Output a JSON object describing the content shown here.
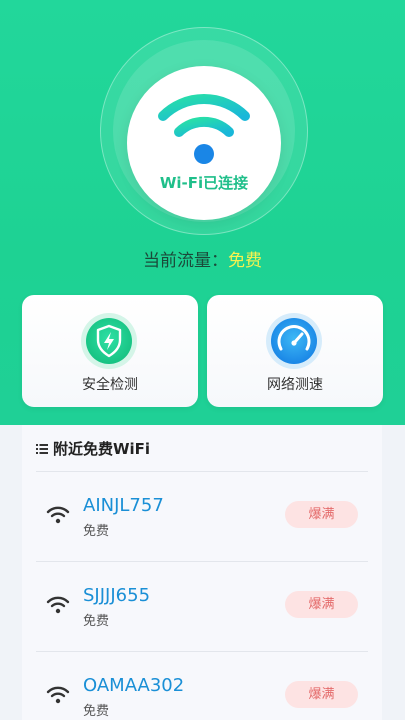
{
  "status": {
    "connection_label": "Wi-Fi已连接",
    "traffic_prefix": "当前流量：",
    "traffic_value": "免费"
  },
  "actions": [
    {
      "label": "安全检测",
      "icon": "shield-lightning-icon"
    },
    {
      "label": "网络测速",
      "icon": "speedometer-icon"
    }
  ],
  "nearby": {
    "title": "附近免费WiFi",
    "networks": [
      {
        "ssid": "AINJL757",
        "sub": "免费",
        "badge": "爆满"
      },
      {
        "ssid": "SJJJJ655",
        "sub": "免费",
        "badge": "爆满"
      },
      {
        "ssid": "OAMAA302",
        "sub": "免费",
        "badge": "爆满"
      }
    ]
  },
  "colors": {
    "brand_green": "#1ed293",
    "ssid_blue": "#1a8fd6",
    "badge_bg": "#fde3e3",
    "badge_text": "#e46a6a",
    "traffic_value": "#f7f250"
  }
}
